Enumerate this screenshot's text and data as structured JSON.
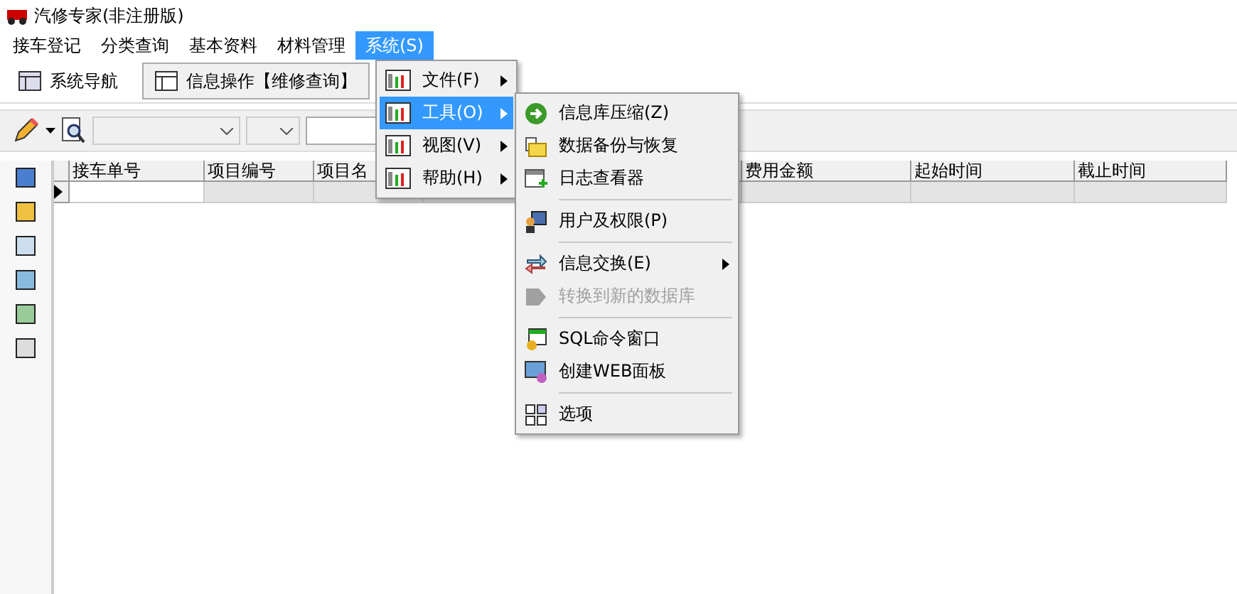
{
  "window": {
    "title": "汽修专家(非注册版)"
  },
  "menu_bar": [
    {
      "label": "接车登记",
      "selected": false
    },
    {
      "label": "分类查询",
      "selected": false
    },
    {
      "label": "基本资料",
      "selected": false
    },
    {
      "label": "材料管理",
      "selected": false
    },
    {
      "label": "系统(S)",
      "selected": true
    }
  ],
  "tabs": [
    {
      "label": "系统导航",
      "selected": false
    },
    {
      "label": "信息操作【维修查询】",
      "selected": true
    }
  ],
  "table": {
    "columns": [
      "接车单号",
      "项目编号",
      "项目名",
      "",
      "费用金额",
      "起始时间",
      "截止时间"
    ]
  },
  "system_menu": [
    {
      "label": "文件(F)",
      "selected": false,
      "has_submenu": true
    },
    {
      "label": "工具(O)",
      "selected": true,
      "has_submenu": true
    },
    {
      "label": "视图(V)",
      "selected": false,
      "has_submenu": true
    },
    {
      "label": "帮助(H)",
      "selected": false,
      "has_submenu": true
    }
  ],
  "tools_menu": [
    [
      {
        "label": "信息库压缩(Z)",
        "disabled": false,
        "has_submenu": false
      },
      {
        "label": "数据备份与恢复",
        "disabled": false,
        "has_submenu": false
      },
      {
        "label": "日志查看器",
        "disabled": false,
        "has_submenu": false
      }
    ],
    [
      {
        "label": "用户及权限(P)",
        "disabled": false,
        "has_submenu": false
      }
    ],
    [
      {
        "label": "信息交换(E)",
        "disabled": false,
        "has_submenu": true
      },
      {
        "label": "转换到新的数据库",
        "disabled": true,
        "has_submenu": false
      }
    ],
    [
      {
        "label": "SQL命令窗口",
        "disabled": false,
        "has_submenu": false
      },
      {
        "label": "创建WEB面板",
        "disabled": false,
        "has_submenu": false
      }
    ],
    [
      {
        "label": "选项",
        "disabled": false,
        "has_submenu": false
      }
    ]
  ]
}
